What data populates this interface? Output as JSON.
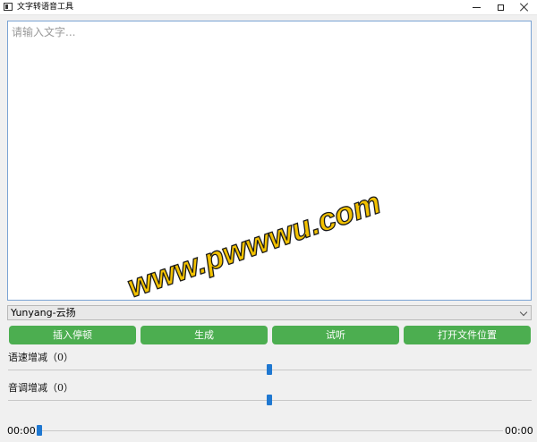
{
  "window": {
    "title": "文字转语音工具"
  },
  "editor": {
    "placeholder": "请输入文字...",
    "value": ""
  },
  "watermark": {
    "text": "www.pwwwu.com"
  },
  "voice_select": {
    "selected": "Yunyang-云扬"
  },
  "buttons": {
    "insert_pause": "插入停顿",
    "generate": "生成",
    "listen": "试听",
    "open_location": "打开文件位置"
  },
  "rate": {
    "label": "语速增减（0）",
    "value": 0
  },
  "pitch": {
    "label": "音调增减（0）",
    "value": 0
  },
  "player": {
    "current_time": "00:00",
    "total_time": "00:00",
    "progress": 0
  },
  "colors": {
    "button_green": "#4cae50",
    "slider_blue": "#1f78d1",
    "watermark_yellow": "#f2c100"
  }
}
